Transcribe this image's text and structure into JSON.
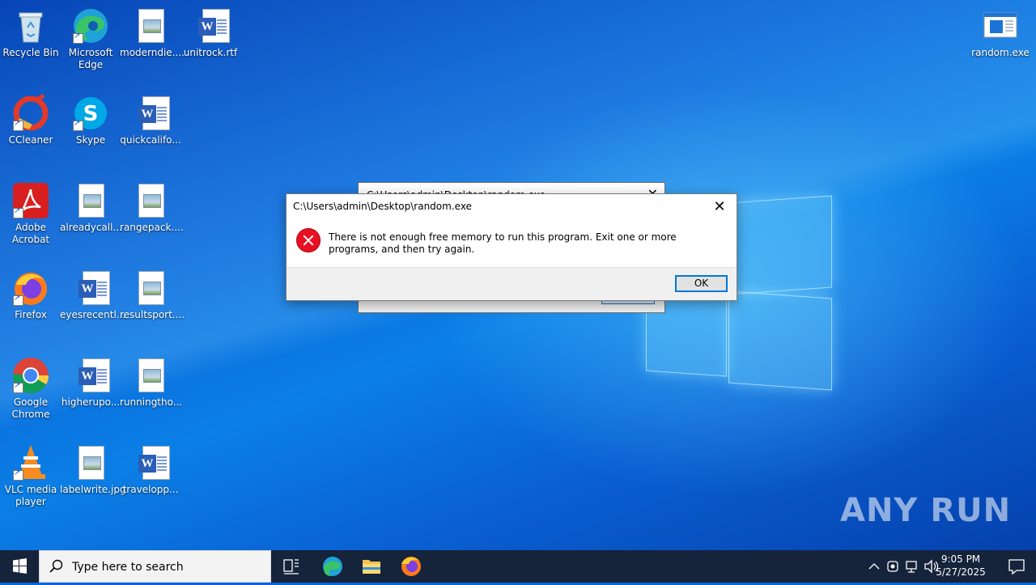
{
  "desktop": {
    "icons": [
      {
        "label": "Recycle Bin",
        "icon": "recycle-bin-icon"
      },
      {
        "label": "Microsoft\nEdge",
        "icon": "edge-icon"
      },
      {
        "label": "moderndie....",
        "icon": "image-file-icon"
      },
      {
        "label": "unitrock.rtf",
        "icon": "word-doc-icon"
      },
      {
        "label": "CCleaner",
        "icon": "ccleaner-icon"
      },
      {
        "label": "Skype",
        "icon": "skype-icon"
      },
      {
        "label": "quickcalifo...",
        "icon": "word-doc-icon"
      },
      {
        "label": "Adobe\nAcrobat",
        "icon": "acrobat-icon"
      },
      {
        "label": "alreadycall...",
        "icon": "image-file-icon"
      },
      {
        "label": "rangepack....",
        "icon": "image-file-icon"
      },
      {
        "label": "Firefox",
        "icon": "firefox-icon"
      },
      {
        "label": "eyesrecentl...",
        "icon": "word-doc-icon"
      },
      {
        "label": "resultsport....",
        "icon": "image-file-icon"
      },
      {
        "label": "Google\nChrome",
        "icon": "chrome-icon"
      },
      {
        "label": "higherupo...",
        "icon": "word-doc-icon"
      },
      {
        "label": "runningtho...",
        "icon": "image-file-icon"
      },
      {
        "label": "VLC media\nplayer",
        "icon": "vlc-icon"
      },
      {
        "label": "labelwrite.jpg",
        "icon": "image-file-icon"
      },
      {
        "label": "travelopp...",
        "icon": "word-doc-icon"
      },
      {
        "label": "random.exe",
        "icon": "exe-icon"
      }
    ]
  },
  "back_dialog": {
    "title": "C:\\Users\\admin\\Desktop\\random.exe",
    "close": "✕"
  },
  "dialog": {
    "title": "C:\\Users\\admin\\Desktop\\random.exe",
    "close": "✕",
    "message": "There is not enough free memory to run this program. Exit one or more programs, and then try again.",
    "ok_label": "OK",
    "icon": "error-icon"
  },
  "watermark": "ANY RUN",
  "taskbar": {
    "search_placeholder": "Type here to search",
    "time": "9:05 PM",
    "date": "5/27/2025",
    "pinned": [
      "task-view-icon",
      "edge-icon",
      "file-explorer-icon",
      "firefox-icon"
    ]
  }
}
